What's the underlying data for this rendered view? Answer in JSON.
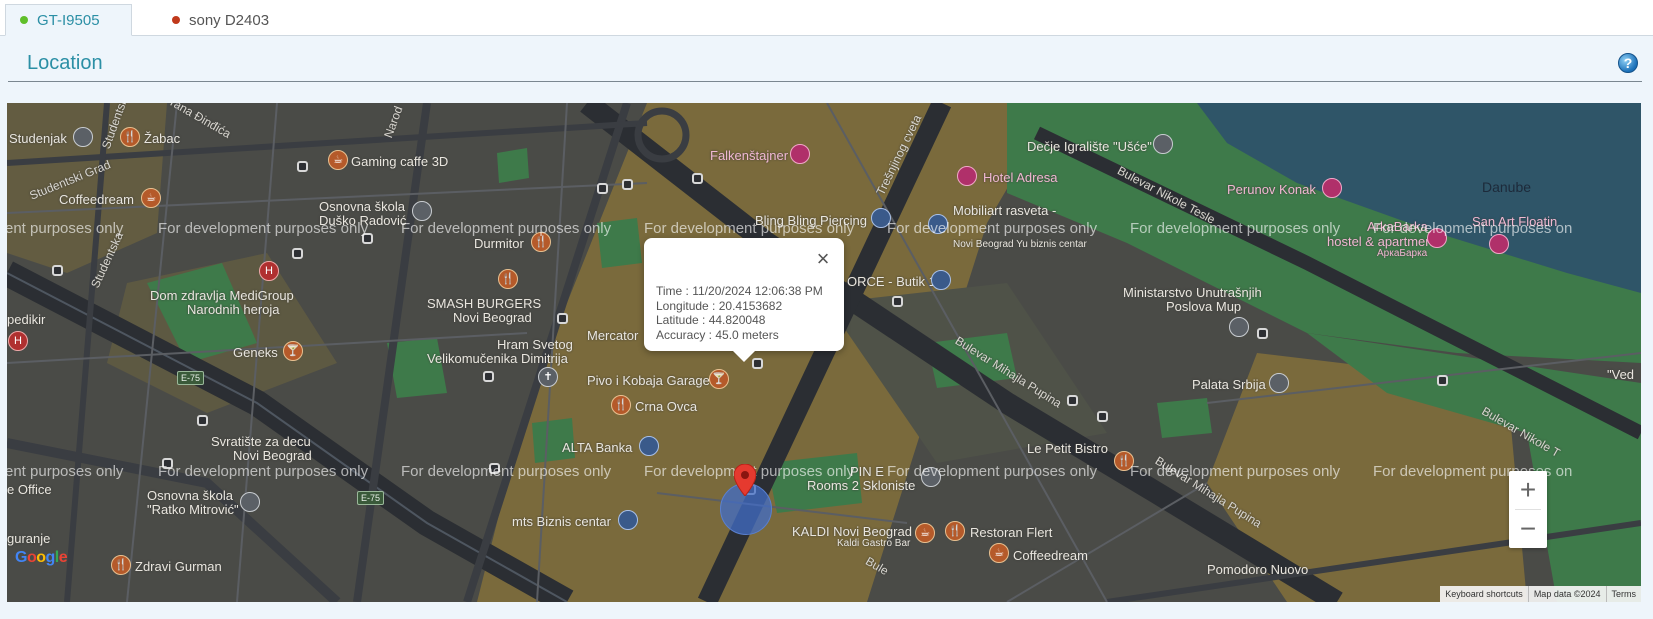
{
  "tabs": [
    {
      "label": "GT-I9505",
      "status_color": "#5fbf2a",
      "active": true
    },
    {
      "label": "sony D2403",
      "status_color": "#c0391b",
      "active": false
    }
  ],
  "section": {
    "title": "Location",
    "help_icon": "help-circle-icon"
  },
  "map": {
    "watermark": "For development purposes only",
    "watermark_left_fragment": "ent purposes only",
    "watermark_right_fragment": "For development purposes on",
    "info": {
      "time": "Time : 11/20/2024 12:06:38 PM",
      "longitude": "Longitude : 20.4153682",
      "latitude": "Latitude : 44.820048",
      "accuracy": "Accuracy : 45.0 meters",
      "close_icon": "close-icon"
    },
    "labels": {
      "studenjak": "Studenjak",
      "zabac": "Žabac",
      "gaming": "Gaming caffe 3D",
      "coffeedream": "Coffeedream",
      "osnovna1": "Osnovna škola",
      "osnovna1b": "Duško Radović",
      "durmitor": "Durmitor",
      "dom_zdravlja": "Dom zdravlja MediGroup",
      "narodnih": "Narodnih heroja",
      "smash": "SMASH BURGERS",
      "novi_beograd": "Novi Beograd",
      "mercator": "Mercator",
      "hram": "Hram Svetog",
      "velikomucenika": "Velikomučenika Dimitrija",
      "geneks": "Geneks",
      "pivo": "Pivo i Kobaja Garage",
      "crna_ovca": "Crna Ovca",
      "alta": "ALTA Banka",
      "svratiste": "Svratište za decu",
      "svratiste_b": "Novi Beograd",
      "osnovna2": "Osnovna škola",
      "osnovna2b": "\"Ratko Mitrović\"",
      "mts": "mts Biznis centar",
      "zdravi": "Zdravi Gurman",
      "kaldi": "KALDI Novi Beograd",
      "kaldi_b": "Kaldi Gastro Bar",
      "restoran_flert": "Restoran Flert",
      "coffeedream2": "Coffeedream",
      "pomodoro": "Pomodoro Nuovo",
      "rooms": "Rooms 2 Skloniste",
      "pin_e": "PIN E",
      "le_petit": "Le Petit Bistro",
      "falkenstajner": "Falkenštajner",
      "bling": "Bling Bling Piercing",
      "dečje": "Dečje Igralište \"Ušće\"",
      "hotel_adresa": "Hotel Adresa",
      "mobiliart": "Mobiliart rasveta -",
      "mobiliart_b": "Novi Beograd Yu biznis centar",
      "orce": "ORCE - Butik 1",
      "perunov": "Perunov Konak",
      "danube": "Danube",
      "arkabarka": "ArkaBarka",
      "hostel": "hostel & apartments",
      "arkabarka_cyr": "АркаБарка",
      "san_art": "San Art Floatin",
      "ministarstvo": "Ministarstvo Unutrašnjih",
      "ministarstvo_b": "Poslova Mup",
      "palata": "Palata Srbija",
      "ved": "\"Ved",
      "pedikir": "pedikir",
      "e_office": "e Office",
      "guranje": "guranje",
      "bul_mihajla": "Bulevar Mihajla Pupina",
      "bul_mihajla2": "Bulevar Mihajla Pupina",
      "bul_nikole": "Bulevar Nikole Tesle",
      "bul_nikole2": "Bulevar Nikole T",
      "tresnjinog": "Trešnjinog cveta",
      "studentska": "Studentska",
      "studentski_grad": "Studentski Grad",
      "studentski": "Studentski",
      "irana": "rana Đinđića",
      "narodnih_rd": "Narod",
      "e75": "E-75",
      "bul_short": "Bule"
    },
    "zoom_in": "+",
    "zoom_out": "−",
    "google": "Google",
    "attribution": {
      "shortcuts": "Keyboard shortcuts",
      "map_data": "Map data ©2024",
      "terms": "Terms"
    }
  }
}
